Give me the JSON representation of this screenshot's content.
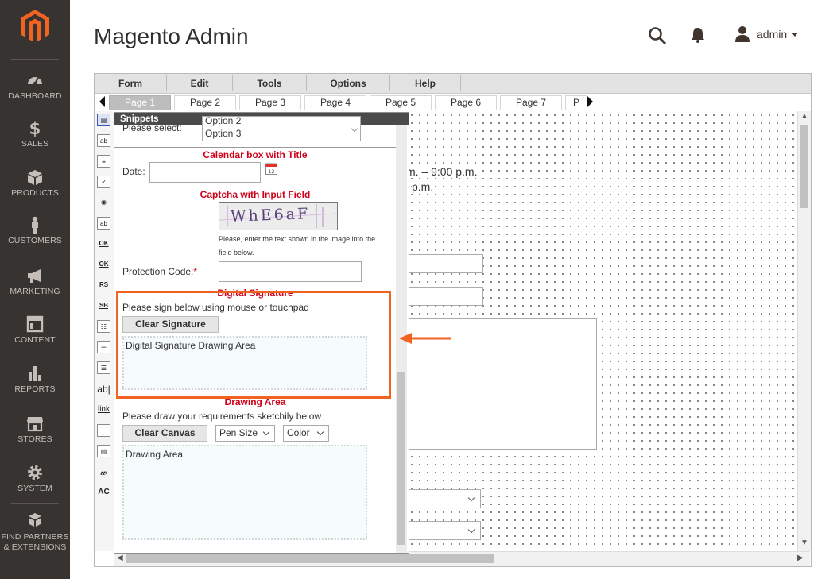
{
  "sidebar": {
    "logo": "magento-logo",
    "items": [
      {
        "label": "DASHBOARD",
        "icon": "dashboard-icon"
      },
      {
        "label": "SALES",
        "icon": "dollar-icon"
      },
      {
        "label": "PRODUCTS",
        "icon": "cube-icon"
      },
      {
        "label": "CUSTOMERS",
        "icon": "person-icon"
      },
      {
        "label": "MARKETING",
        "icon": "megaphone-icon"
      },
      {
        "label": "CONTENT",
        "icon": "layout-icon"
      },
      {
        "label": "REPORTS",
        "icon": "bar-chart-icon"
      },
      {
        "label": "STORES",
        "icon": "store-icon"
      },
      {
        "label": "SYSTEM",
        "icon": "gear-icon"
      },
      {
        "label": "FIND PARTNERS & EXTENSIONS",
        "icon": "blocks-icon"
      }
    ]
  },
  "header": {
    "title": "Magento Admin",
    "user": "admin"
  },
  "editor": {
    "menu": [
      "Form",
      "Edit",
      "Tools",
      "Options",
      "Help"
    ],
    "pages": [
      "Page 1",
      "Page 2",
      "Page 3",
      "Page 4",
      "Page 5",
      "Page 6",
      "Page 7",
      "P"
    ],
    "active_page": "Page 1",
    "background_text": {
      "time_line": "m. – 9:00 p.m.",
      "time_line2": "p.m."
    }
  },
  "snippets": {
    "title": "Snippets",
    "please_select_label": "Please select:",
    "options": [
      "Option 2",
      "Option 3"
    ],
    "calendar": {
      "heading": "Calendar box with Title",
      "label": "Date:",
      "icon": "calendar-icon"
    },
    "captcha": {
      "heading": "Captcha with Input Field",
      "image_text": "WhE6aF",
      "hint_line1": "Please, enter the text shown in the image into the",
      "hint_line2": "field below.",
      "label": "Protection Code:",
      "required_mark": "*"
    },
    "signature": {
      "heading": "Digital Signature",
      "instruction": "Please sign below using mouse or touchpad",
      "clear_button": "Clear Signature",
      "area_text": "Digital Signature Drawing Area"
    },
    "drawing": {
      "heading": "Drawing Area",
      "instruction": "Please draw your requirements sketchily below",
      "clear_button": "Clear Canvas",
      "pen_size": "Pen Size",
      "color": "Color",
      "area_text": "Drawing Area"
    }
  },
  "colors": {
    "sidebar_bg": "#373330",
    "accent": "#f26322",
    "heading_red": "#d0021b"
  }
}
